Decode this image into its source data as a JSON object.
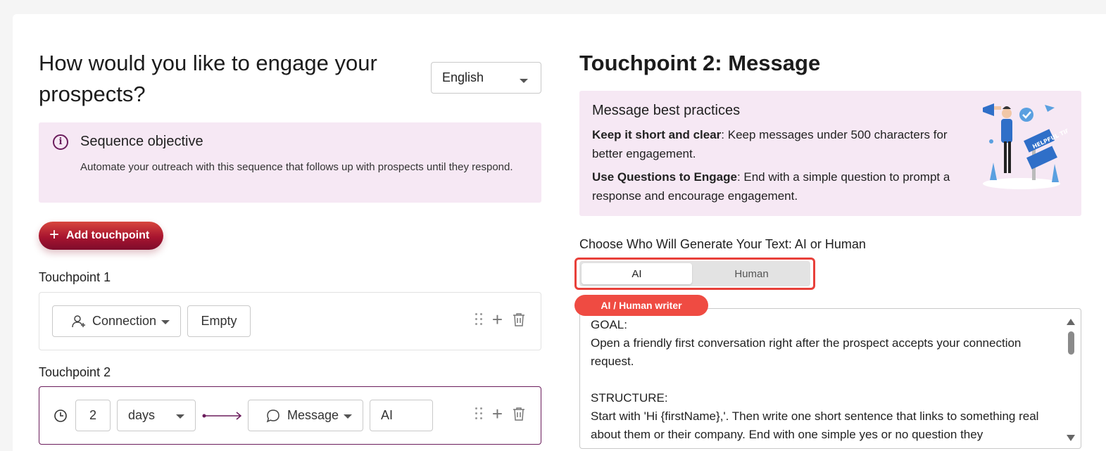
{
  "left": {
    "title": "How would you like to engage your prospects?",
    "language": {
      "selected": "English"
    },
    "objective": {
      "title": "Sequence objective",
      "description": "Automate your outreach with this sequence that follows up with prospects until they respond."
    },
    "add_touchpoint_label": "Add touchpoint",
    "touchpoints": [
      {
        "label": "Touchpoint 1",
        "action": "Connection",
        "content": "Empty"
      },
      {
        "label": "Touchpoint 2",
        "delay_value": "2",
        "delay_unit": "days",
        "action": "Message",
        "writer": "AI"
      }
    ]
  },
  "right": {
    "title": "Touchpoint 2: Message",
    "tips": {
      "title": "Message best practices",
      "items": [
        {
          "bold": "Keep it short and clear",
          "text": ": Keep messages under 500 characters for better engagement."
        },
        {
          "bold": "Use Questions to Engage",
          "text": ": End with a simple question to prompt a response and encourage engagement."
        }
      ],
      "illustration_text": "HELPFUL TIPS!"
    },
    "generator": {
      "label": "Choose Who Will Generate Your Text: AI or Human",
      "options": [
        "AI",
        "Human"
      ],
      "selected": "AI",
      "badge": "AI / Human writer"
    },
    "prompt": "GOAL:\nOpen a friendly first conversation right after the prospect accepts your connection request.\n\nSTRUCTURE:\nStart with 'Hi {firstName},'. Then write one short sentence that links to something real about them or their company. End with one simple yes or no question they"
  },
  "colors": {
    "accent": "#6b1d5c",
    "panel_bg": "#f6e8f4",
    "button_red": "#a8142f",
    "highlight": "#e8403a"
  }
}
